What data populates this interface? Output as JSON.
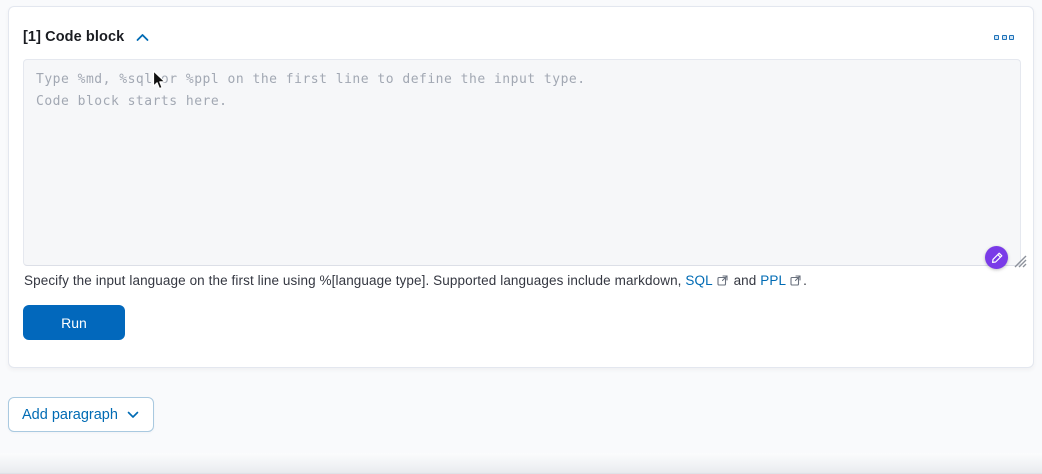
{
  "panel": {
    "header": {
      "title": "[1] Code block"
    },
    "editor": {
      "placeholder": "Type %md, %sql or %ppl on the first line to define the input type.\nCode block starts here.",
      "value": ""
    },
    "help": {
      "text_before": "Specify the input language on the first line using %[language type]. Supported languages include markdown, ",
      "sql_link": "SQL",
      "text_between": " and ",
      "ppl_link": "PPL",
      "text_after": "."
    },
    "run_button": "Run"
  },
  "add_paragraph_button": "Add paragraph",
  "icons": {
    "collapse": "chevron-up-icon",
    "paragraph_actions": "boxes-horizontal-icon",
    "external_link": "external-link-icon",
    "assistant_badge": "pen-badge-icon",
    "resize": "resize-grip",
    "cursor": "mouse-cursor"
  },
  "colors": {
    "primary_link": "#006bb4",
    "run_button_bg": "#0268bc",
    "assistant_badge_bg": "#7a3be8",
    "placeholder_text": "#a2a8b3",
    "textarea_bg": "#f6f7f9",
    "panel_border": "#e3e7ef",
    "page_bg": "#f9fafc"
  }
}
